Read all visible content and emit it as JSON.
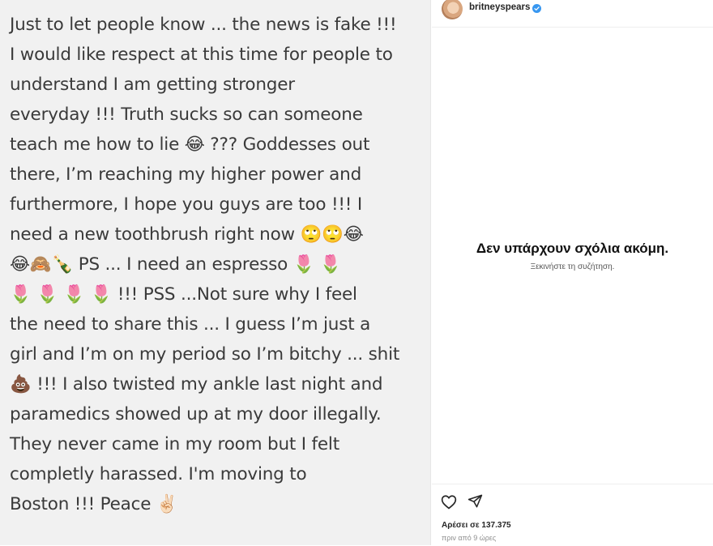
{
  "post": {
    "lines": [
      "Just to let people know ... the news is fake !!!",
      "I would like respect at this time for people to",
      "understand I am getting stronger",
      "everyday !!! Truth sucks so can someone",
      "teach me how to lie 😂 ??? Goddesses out",
      "there, I’m reaching my higher power and",
      "furthermore, I hope you guys are too !!! I",
      "need a new toothbrush right now 🙄🙄😂",
      "😂🙈🍾 PS ... I need an espresso 🌷 🌷",
      "🌷 🌷 🌷 🌷 !!! PSS ...Not sure why I feel",
      "the need to share this ... I guess I’m just a",
      "girl and I’m on my period so I’m bitchy ... shit",
      "💩 !!! I also twisted my ankle last night and",
      "paramedics showed up at my door illegally.",
      "They never came in my room but I felt",
      "completly harassed.  I'm moving to",
      "Boston !!! Peace ✌🏻"
    ]
  },
  "header": {
    "username": "britneyspears",
    "avatar_icon": "profile-avatar",
    "verified_icon": "verified-badge-icon",
    "verified_color": "#3897f0"
  },
  "comments": {
    "empty_title": "Δεν υπάρχουν σχόλια ακόμη.",
    "empty_subtitle": "Ξεκινήστε τη συζήτηση."
  },
  "actions": {
    "like_icon": "heart-icon",
    "share_icon": "paper-plane-icon"
  },
  "meta": {
    "likes": "Αρέσει σε 137.375",
    "time": "πριν από 9 ώρες"
  }
}
